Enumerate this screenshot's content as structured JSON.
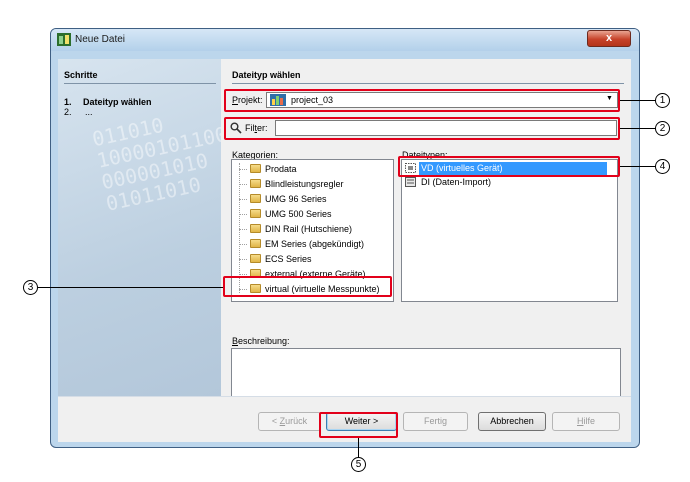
{
  "window": {
    "title": "Neue Datei",
    "close_label": "x"
  },
  "left_pane": {
    "header": "Schritte",
    "watermark": "011010\n10000101100\n000001010\n01011010",
    "steps": [
      {
        "num": "1.",
        "label": "Dateityp wählen"
      },
      {
        "num": "2.",
        "label": "..."
      }
    ]
  },
  "main": {
    "section_title": "Dateityp wählen",
    "project": {
      "label_prefix": "P",
      "label_rest": "rojekt:",
      "value": "project_03"
    },
    "filter": {
      "label_prefix": "Fil",
      "label_u": "t",
      "label_rest": "er:",
      "value": ""
    },
    "categories": {
      "label_prefix": "K",
      "label_rest": "ategorien:",
      "items": [
        "Prodata",
        "Blindleistungsregler",
        "UMG 96 Series",
        "UMG 500 Series",
        "DIN Rail (Hutschiene)",
        "EM Series (abgekündigt)",
        "ECS Series",
        "external (externe Geräte)",
        "virtual (virtuelle Messpunkte)"
      ]
    },
    "filetypes": {
      "label": "Dateitypen:",
      "items": [
        {
          "label": "VD (virtuelles Gerät)",
          "selected": true
        },
        {
          "label": "DI (Daten-Import)",
          "selected": false
        }
      ]
    },
    "description": {
      "label_prefix": "B",
      "label_rest": "eschreibung:",
      "value": ""
    }
  },
  "buttons": {
    "back": {
      "label_prefix": "< ",
      "label_u": "Z",
      "label_rest": "urück"
    },
    "next": "Weiter >",
    "finish": "Fertig",
    "cancel": "Abbrechen",
    "help": {
      "label_u": "H",
      "label_rest": "ilfe"
    }
  },
  "callouts": [
    "1",
    "2",
    "3",
    "4",
    "5"
  ],
  "colors": {
    "highlight": "#e2001a",
    "selection": "#3399ff",
    "titlebar": "#bcd6ec",
    "close_button": "#c7432a"
  }
}
